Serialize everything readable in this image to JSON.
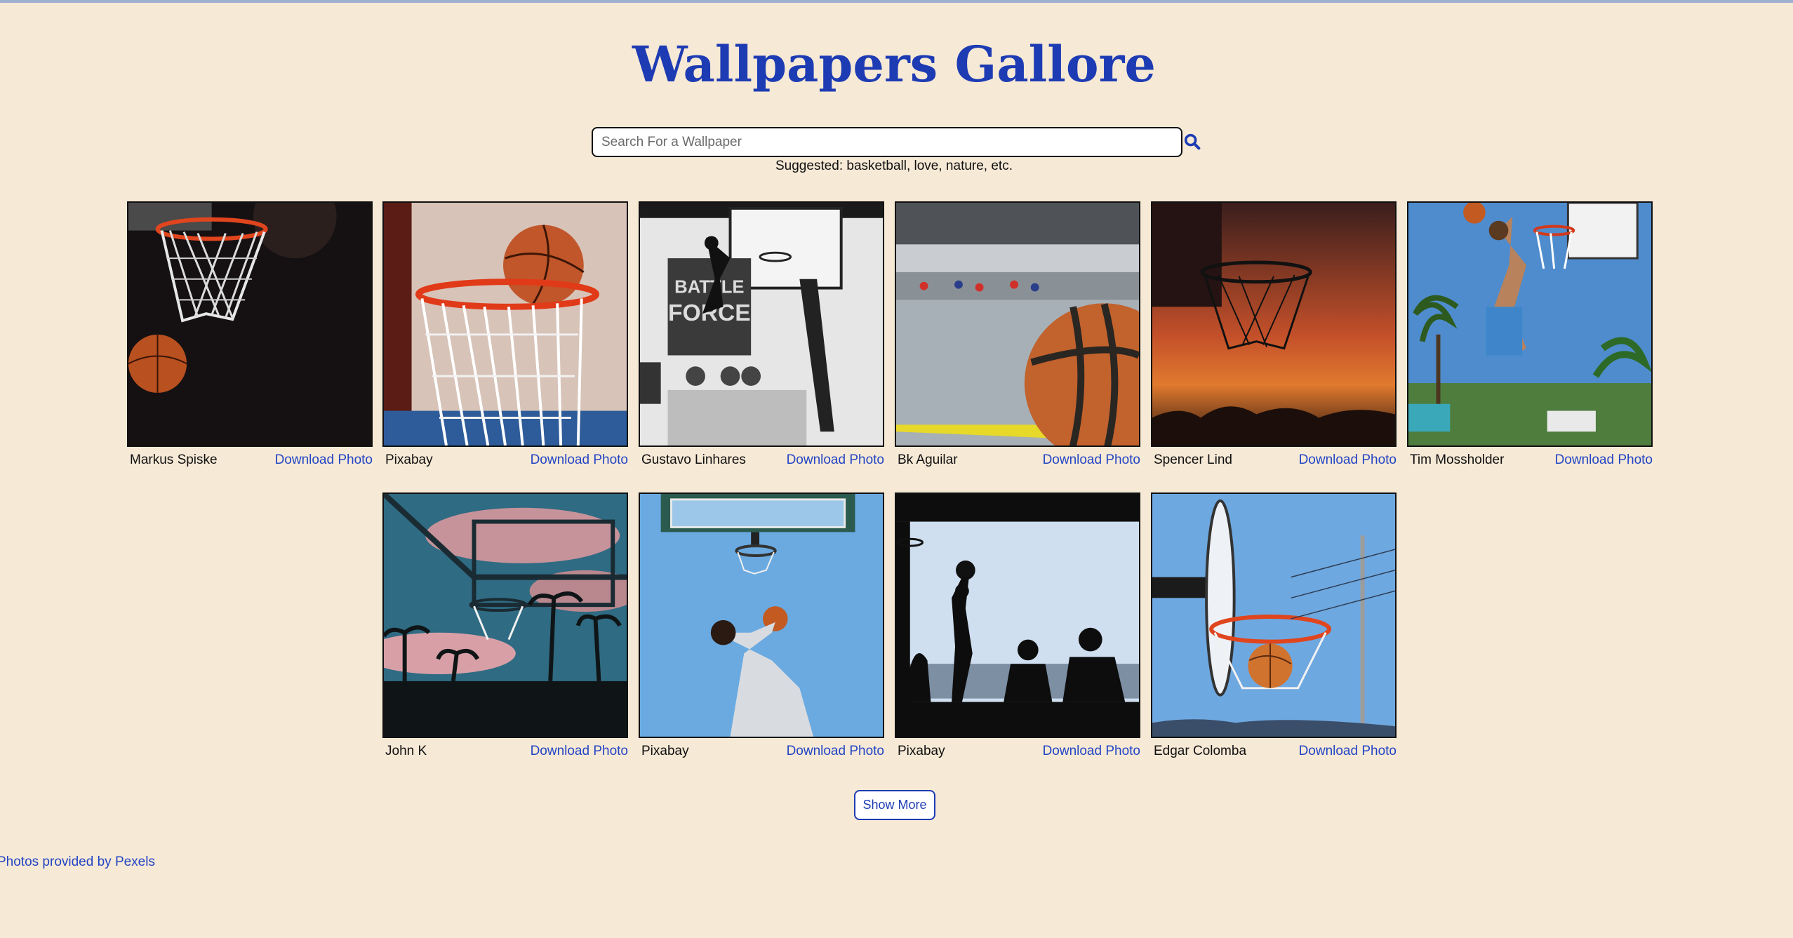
{
  "header": {
    "title": "Wallpapers Gallore"
  },
  "search": {
    "placeholder": "Search For a Wallpaper",
    "value": "",
    "button_icon": "magnifier-search-icon",
    "suggestion": "Suggested: basketball, love, nature, etc."
  },
  "gallery": {
    "download_label": "Download Photo",
    "photos": [
      {
        "photographer": "Markus Spiske",
        "subject": "net-with-ball-dark"
      },
      {
        "photographer": "Pixabay",
        "subject": "ball-on-rim"
      },
      {
        "photographer": "Gustavo Linhares",
        "subject": "dunk-black-and-white"
      },
      {
        "photographer": "Bk Aguilar",
        "subject": "ball-on-court"
      },
      {
        "photographer": "Spencer Lind",
        "subject": "hoop-at-sunset"
      },
      {
        "photographer": "Tim Mossholder",
        "subject": "dunk-with-palms"
      },
      {
        "photographer": "John K",
        "subject": "hoop-with-palms-and-clouds"
      },
      {
        "photographer": "Pixabay",
        "subject": "layup-blue-sky"
      },
      {
        "photographer": "Pixabay",
        "subject": "silhouettes-by-sea"
      },
      {
        "photographer": "Edgar Colomba",
        "subject": "hoop-blue-sky"
      }
    ]
  },
  "actions": {
    "show_more": "Show More"
  },
  "footer": {
    "credit": "Photos provided by Pexels"
  },
  "colors": {
    "background": "#f6e9d6",
    "accent": "#1d3bb3",
    "link": "#2345c4"
  }
}
